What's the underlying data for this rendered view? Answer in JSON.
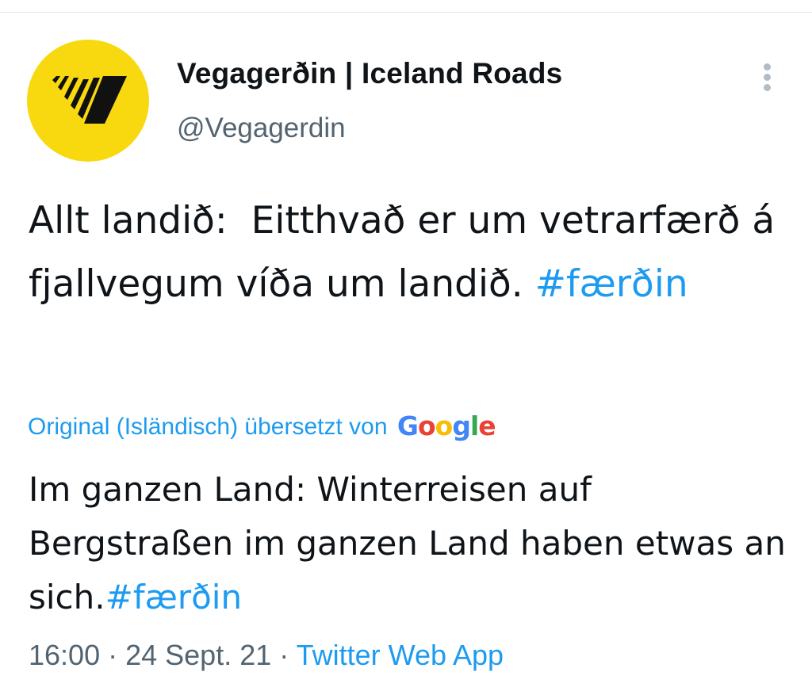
{
  "account": {
    "display_name": "Vegagerðin | Iceland Roads",
    "handle": "@Vegagerdin"
  },
  "tweet": {
    "text": "Allt landið:  Eitthvað er um vetrarfærð á fjallvegum víða um landið. ",
    "hashtag": "#færðin"
  },
  "translation": {
    "attribution": "Original (Isländisch) übersetzt von",
    "provider_letters": [
      "G",
      "o",
      "o",
      "g",
      "l",
      "e"
    ],
    "text": "Im ganzen Land: Winterreisen auf Bergstraßen im ganzen Land haben etwas an sich.",
    "hashtag": "#færðin"
  },
  "meta": {
    "time": "16:00",
    "separator": " · ",
    "date": "24 Sept. 21",
    "source": "Twitter Web App"
  },
  "icons": {
    "avatar_logo": "vegagerdin-logo",
    "more": "more-vertical-icon"
  },
  "colors": {
    "avatar_bg": "#f8d90f",
    "link": "#1d9bf0",
    "secondary_text": "#536471",
    "primary_text": "#0f1419"
  }
}
